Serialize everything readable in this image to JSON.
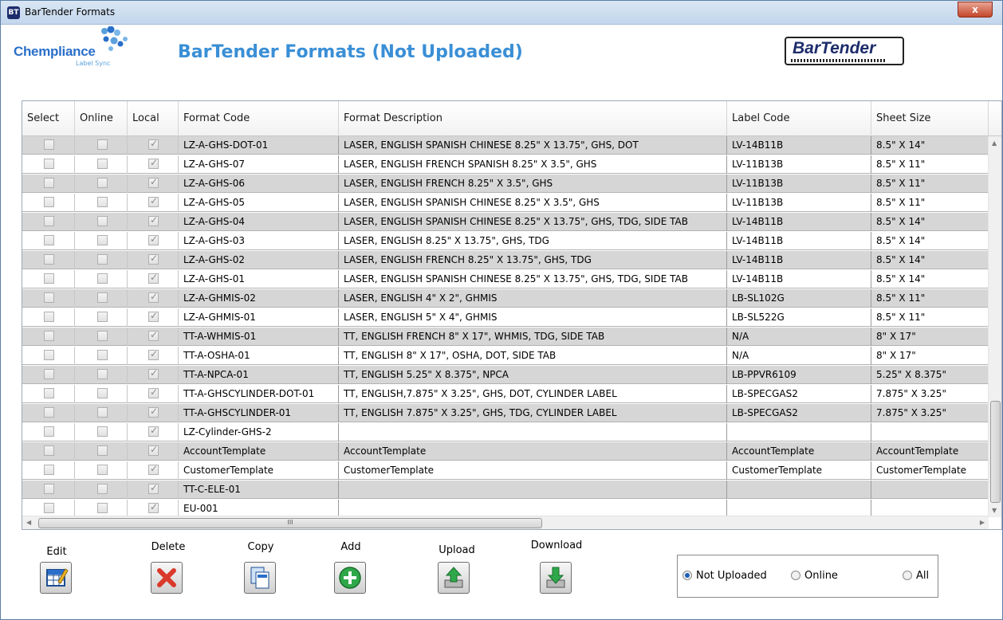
{
  "window": {
    "title": "BarTender Formats",
    "close_label": "x"
  },
  "header": {
    "brand_name": "Chempliance",
    "brand_sub": "Label Sync",
    "page_title": "BarTender Formats (Not Uploaded)",
    "logo_text": "BarTender"
  },
  "grid": {
    "columns": [
      "Select",
      "Online",
      "Local",
      "Format Code",
      "Format Description",
      "Label Code",
      "Sheet Size"
    ],
    "rows": [
      {
        "select": false,
        "online": false,
        "local": true,
        "format_code": "LZ-A-GHS-DOT-01",
        "format_description": "LASER, ENGLISH SPANISH CHINESE 8.25\" X 13.75\", GHS, DOT",
        "label_code": "LV-14B11B",
        "sheet_size": "8.5\" X 14\""
      },
      {
        "select": false,
        "online": false,
        "local": true,
        "format_code": "LZ-A-GHS-07",
        "format_description": "LASER, ENGLISH FRENCH SPANISH 8.25\" X 3.5\", GHS",
        "label_code": "LV-11B13B",
        "sheet_size": "8.5\" X 11\""
      },
      {
        "select": false,
        "online": false,
        "local": true,
        "format_code": "LZ-A-GHS-06",
        "format_description": "LASER, ENGLISH FRENCH 8.25\" X 3.5\", GHS",
        "label_code": "LV-11B13B",
        "sheet_size": "8.5\" X 11\""
      },
      {
        "select": false,
        "online": false,
        "local": true,
        "format_code": "LZ-A-GHS-05",
        "format_description": "LASER, ENGLISH SPANISH CHINESE 8.25\" X 3.5\", GHS",
        "label_code": "LV-11B13B",
        "sheet_size": "8.5\" X 11\""
      },
      {
        "select": false,
        "online": false,
        "local": true,
        "format_code": "LZ-A-GHS-04",
        "format_description": "LASER, ENGLISH SPANISH CHINESE 8.25\" X 13.75\", GHS, TDG, SIDE TAB",
        "label_code": "LV-14B11B",
        "sheet_size": "8.5\" X 14\""
      },
      {
        "select": false,
        "online": false,
        "local": true,
        "format_code": "LZ-A-GHS-03",
        "format_description": "LASER, ENGLISH 8.25\" X 13.75\", GHS, TDG",
        "label_code": "LV-14B11B",
        "sheet_size": "8.5\" X 14\""
      },
      {
        "select": false,
        "online": false,
        "local": true,
        "format_code": "LZ-A-GHS-02",
        "format_description": "LASER, ENGLISH FRENCH 8.25\" X 13.75\", GHS, TDG",
        "label_code": "LV-14B11B",
        "sheet_size": "8.5\" X 14\""
      },
      {
        "select": false,
        "online": false,
        "local": true,
        "format_code": "LZ-A-GHS-01",
        "format_description": "LASER, ENGLISH SPANISH CHINESE 8.25\" X 13.75\", GHS, TDG, SIDE TAB",
        "label_code": "LV-14B11B",
        "sheet_size": "8.5\" X 14\""
      },
      {
        "select": false,
        "online": false,
        "local": true,
        "format_code": "LZ-A-GHMIS-02",
        "format_description": "LASER, ENGLISH 4\" X 2\", GHMIS",
        "label_code": "LB-SL102G",
        "sheet_size": "8.5\" X 11\""
      },
      {
        "select": false,
        "online": false,
        "local": true,
        "format_code": "LZ-A-GHMIS-01",
        "format_description": "LASER, ENGLISH 5\" X 4\", GHMIS",
        "label_code": "LB-SL522G",
        "sheet_size": "8.5\" X 11\""
      },
      {
        "select": false,
        "online": false,
        "local": true,
        "format_code": "TT-A-WHMIS-01",
        "format_description": "TT, ENGLISH FRENCH 8\" X 17\", WHMIS, TDG, SIDE TAB",
        "label_code": "N/A",
        "sheet_size": "8\" X 17\""
      },
      {
        "select": false,
        "online": false,
        "local": true,
        "format_code": "TT-A-OSHA-01",
        "format_description": "TT, ENGLISH 8\" X 17\", OSHA, DOT, SIDE TAB",
        "label_code": "N/A",
        "sheet_size": "8\" X 17\""
      },
      {
        "select": false,
        "online": false,
        "local": true,
        "format_code": "TT-A-NPCA-01",
        "format_description": "TT, ENGLISH 5.25\" X 8.375\", NPCA",
        "label_code": "LB-PPVR6109",
        "sheet_size": "5.25\" X 8.375\""
      },
      {
        "select": false,
        "online": false,
        "local": true,
        "format_code": "TT-A-GHSCYLINDER-DOT-01",
        "format_description": "TT, ENGLISH,7.875\" X 3.25\", GHS, DOT, CYLINDER LABEL",
        "label_code": "LB-SPECGAS2",
        "sheet_size": "7.875\" X 3.25\""
      },
      {
        "select": false,
        "online": false,
        "local": true,
        "format_code": "TT-A-GHSCYLINDER-01",
        "format_description": "TT, ENGLISH 7.875\" X 3.25\", GHS, TDG, CYLINDER LABEL",
        "label_code": "LB-SPECGAS2",
        "sheet_size": "7.875\" X 3.25\""
      },
      {
        "select": false,
        "online": false,
        "local": true,
        "format_code": "LZ-Cylinder-GHS-2",
        "format_description": "",
        "label_code": "",
        "sheet_size": ""
      },
      {
        "select": false,
        "online": false,
        "local": true,
        "format_code": "AccountTemplate",
        "format_description": "AccountTemplate",
        "label_code": "AccountTemplate",
        "sheet_size": "AccountTemplate"
      },
      {
        "select": false,
        "online": false,
        "local": true,
        "format_code": "CustomerTemplate",
        "format_description": "CustomerTemplate",
        "label_code": "CustomerTemplate",
        "sheet_size": "CustomerTemplate"
      },
      {
        "select": false,
        "online": false,
        "local": true,
        "format_code": "TT-C-ELE-01",
        "format_description": "",
        "label_code": "",
        "sheet_size": ""
      },
      {
        "select": false,
        "online": false,
        "local": true,
        "format_code": "EU-001",
        "format_description": "",
        "label_code": "",
        "sheet_size": ""
      }
    ],
    "hscroll_grip": "III"
  },
  "toolbar": {
    "edit_label": "Edit",
    "delete_label": "Delete",
    "copy_label": "Copy",
    "add_label": "Add",
    "upload_label": "Upload",
    "download_label": "Download"
  },
  "filter": {
    "options": [
      "Not Uploaded",
      "Online",
      "All"
    ],
    "selected": "Not Uploaded"
  },
  "colors": {
    "title_blue": "#3a8fd6",
    "brand_blue": "#2a6fc9",
    "alt_row": "#d6d6d6",
    "delete_red": "#d93a2b",
    "add_green": "#2fa84a"
  }
}
